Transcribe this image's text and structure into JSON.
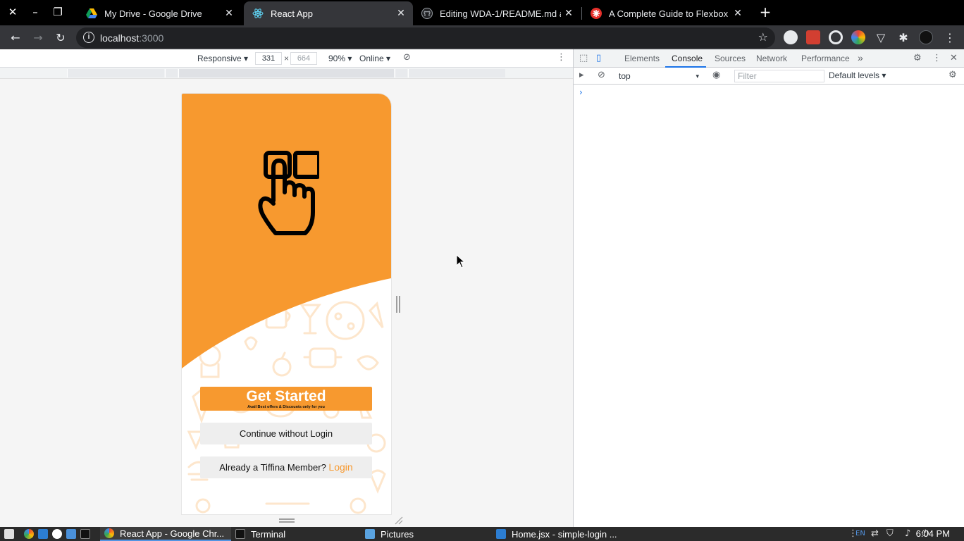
{
  "browser": {
    "tabs": [
      {
        "title": "My Drive - Google Drive",
        "icon": "google-drive-icon",
        "active": false
      },
      {
        "title": "React App",
        "icon": "react-icon",
        "active": true
      },
      {
        "title": "Editing WDA-1/README.md a",
        "icon": "github-icon",
        "active": false
      },
      {
        "title": "A Complete Guide to Flexbox",
        "icon": "css-tricks-icon",
        "active": false
      }
    ],
    "url_host": "localhost",
    "url_port": ":3000"
  },
  "device_toolbar": {
    "device": "Responsive",
    "width": "331",
    "height": "664",
    "times": "×",
    "zoom": "90%",
    "network": "Online"
  },
  "app": {
    "cta_title": "Get Started",
    "cta_subtitle": "Avail Best offers & Discounts only for you",
    "continue_label": "Continue without Login",
    "member_text": "Already a Tiffina Member?",
    "login_label": "Login",
    "colors": {
      "primary": "#f7992f",
      "pattern": "#fde6cc"
    }
  },
  "devtools": {
    "tabs": [
      "Elements",
      "Console",
      "Sources",
      "Network",
      "Performance"
    ],
    "active_tab": "Console",
    "more_tabs": "»",
    "context": "top",
    "filter_placeholder": "Filter",
    "levels": "Default levels",
    "prompt": "›"
  },
  "taskbar": {
    "apps": [
      {
        "label": "React App - Google Chr...",
        "active": true
      },
      {
        "label": "Terminal",
        "active": false
      },
      {
        "label": "Pictures",
        "active": false
      },
      {
        "label": "Home.jsx - simple-login ...",
        "active": false
      }
    ],
    "keyboard": "EN",
    "clock": "6:04 PM"
  }
}
